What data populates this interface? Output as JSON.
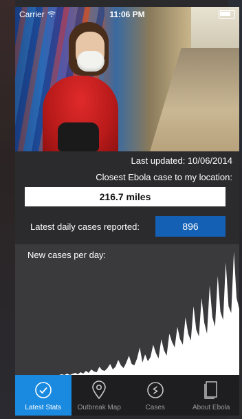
{
  "status_bar": {
    "carrier": "Carrier",
    "time": "11:06 PM"
  },
  "stats": {
    "last_updated": "Last updated: 10/06/2014",
    "closest_label": "Closest Ebola case to my location:",
    "closest_distance": "216.7 miles",
    "daily_label": "Latest daily cases reported:",
    "daily_value": "896"
  },
  "chart_data": {
    "type": "area",
    "title": "New cases per day:",
    "xlabel": "",
    "ylabel": "",
    "grid": false,
    "ylim": [
      0,
      900
    ],
    "series": [
      {
        "values": [
          0,
          0,
          5,
          0,
          10,
          0,
          8,
          15,
          5,
          20,
          10,
          30,
          15,
          40,
          25,
          20,
          60,
          35,
          30,
          50,
          80,
          40,
          60,
          110,
          70,
          50,
          90,
          140,
          80,
          70,
          120,
          200,
          90,
          150,
          100,
          130,
          220,
          160,
          120,
          260,
          180,
          140,
          300,
          240,
          200,
          350,
          260,
          220,
          420,
          300,
          250,
          500,
          330,
          280,
          560,
          380,
          300,
          650,
          420,
          350,
          720,
          460,
          400,
          820,
          500,
          450,
          896,
          560,
          480
        ]
      }
    ],
    "color": "#ffffff"
  },
  "tabs": [
    {
      "label": "Latest Stats",
      "icon": "checkmark-circle-icon",
      "active": true
    },
    {
      "label": "Outbreak Map",
      "icon": "map-pin-icon",
      "active": false
    },
    {
      "label": "Cases",
      "icon": "cases-circle-icon",
      "active": false
    },
    {
      "label": "About Ebola",
      "icon": "document-icon",
      "active": false
    }
  ],
  "colors": {
    "accent": "#1a8ae0",
    "daily_box": "#1360b5"
  }
}
